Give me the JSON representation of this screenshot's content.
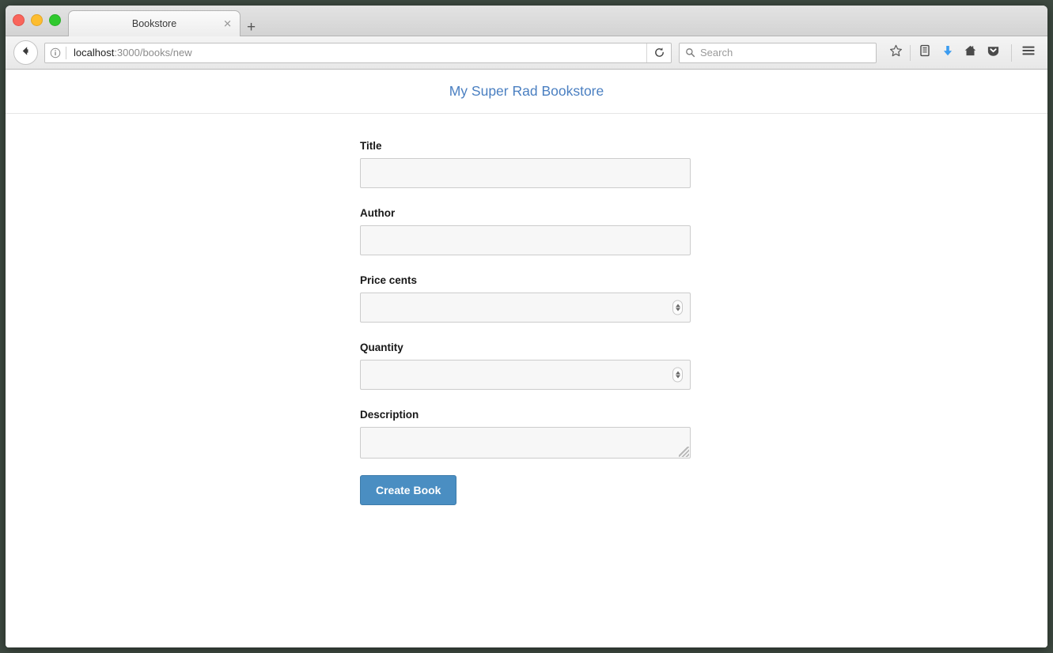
{
  "window": {
    "traffic_lights": [
      {
        "name": "close-window-button",
        "color": "#f9655b"
      },
      {
        "name": "minimize-window-button",
        "color": "#fdbd2f"
      },
      {
        "name": "maximize-window-button",
        "color": "#2fc92e"
      }
    ]
  },
  "tabs": {
    "active": {
      "title": "Bookstore",
      "close_glyph": "✕"
    },
    "new_tab_glyph": "+"
  },
  "toolbar": {
    "back_icon": "back-arrow-icon",
    "info_icon": "page-info-icon",
    "url_host": "localhost",
    "url_path": ":3000/books/new",
    "reload_icon": "reload-icon",
    "search_placeholder": "Search",
    "search_icon": "search-icon",
    "icons": [
      {
        "name": "bookmark-star-icon",
        "label": "Bookmark this page"
      },
      {
        "name": "library-icon",
        "label": "Show your library"
      },
      {
        "name": "downloads-icon",
        "label": "Downloads",
        "color": "#3b9cf0"
      },
      {
        "name": "home-icon",
        "label": "Home"
      },
      {
        "name": "pocket-icon",
        "label": "Save to Pocket"
      },
      {
        "name": "hamburger-menu-icon",
        "label": "Open menu"
      }
    ]
  },
  "page": {
    "site_title": "My Super Rad Bookstore",
    "site_title_color": "#4a7fc1",
    "form": {
      "fields": [
        {
          "label": "Title",
          "type": "text",
          "value": "",
          "name": "title"
        },
        {
          "label": "Author",
          "type": "text",
          "value": "",
          "name": "author"
        },
        {
          "label": "Price cents",
          "type": "number",
          "value": "",
          "name": "price-cents"
        },
        {
          "label": "Quantity",
          "type": "number",
          "value": "",
          "name": "quantity"
        },
        {
          "label": "Description",
          "type": "textarea",
          "value": "",
          "name": "description"
        }
      ],
      "submit_label": "Create Book",
      "submit_color": "#4a8ec2"
    }
  }
}
